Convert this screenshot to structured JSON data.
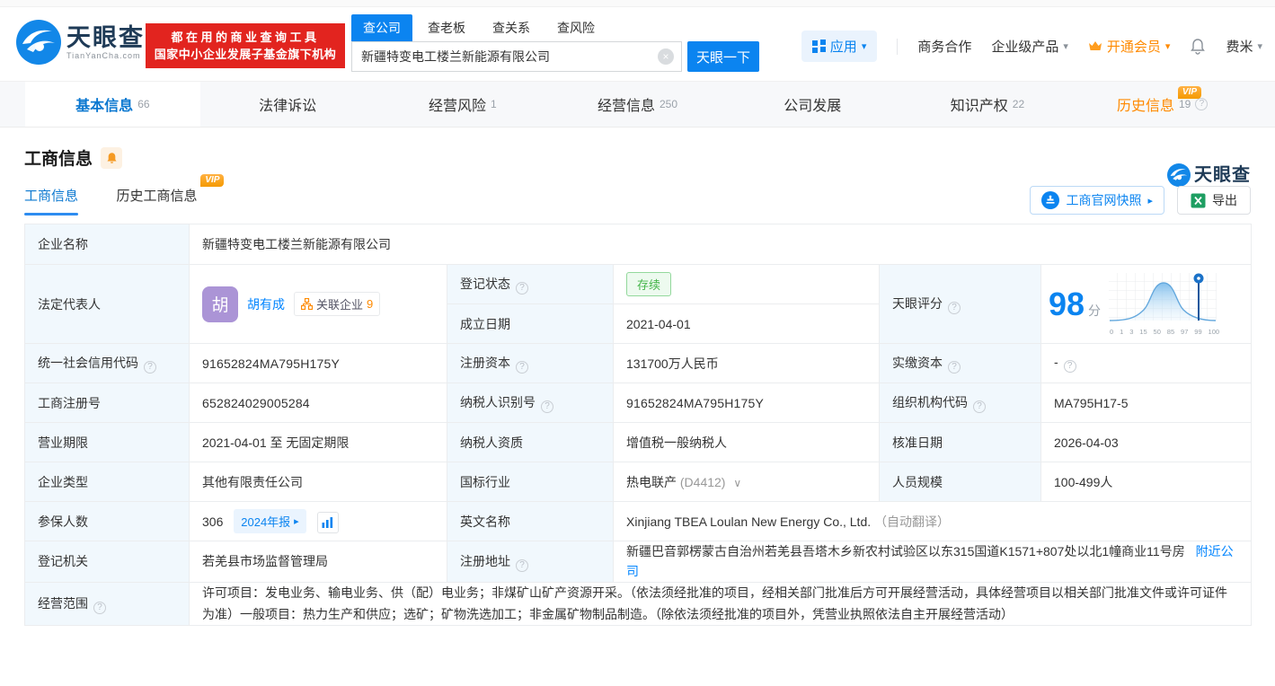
{
  "icons": {
    "caret_down": "▾",
    "play_arrow": "▸",
    "close": "×",
    "help": "?",
    "chevron_down": "∨"
  },
  "badges": {
    "vip": "VIP"
  },
  "colors": {
    "primary_blue": "#0b84f0",
    "link_blue": "#0084ff",
    "brand_red": "#e2241f",
    "vip_orange": "#ff8a00",
    "status_green": "#44b549",
    "label_cell_bg": "#f1f8fd"
  },
  "header": {
    "logo": {
      "brand": "天眼查",
      "domain": "TianYanCha.com"
    },
    "slogan_line1": "都在用的商业查询工具",
    "slogan_line2": "国家中小企业发展子基金旗下机构",
    "search": {
      "tabs": [
        {
          "label": "查公司"
        },
        {
          "label": "查老板"
        },
        {
          "label": "查关系"
        },
        {
          "label": "查风险"
        }
      ],
      "input_value": "新疆特变电工楼兰新能源有限公司",
      "button": "天眼一下"
    },
    "nav": {
      "apps": "应用",
      "cooperation": "商务合作",
      "enterprise": "企业级产品",
      "vip": "开通会员",
      "user": "费米"
    }
  },
  "nav_tabs": [
    {
      "label": "基本信息",
      "count": "66"
    },
    {
      "label": "法律诉讼",
      "count": ""
    },
    {
      "label": "经营风险",
      "count": "1"
    },
    {
      "label": "经营信息",
      "count": "250"
    },
    {
      "label": "公司发展",
      "count": ""
    },
    {
      "label": "知识产权",
      "count": "22"
    },
    {
      "label": "历史信息",
      "count": "19"
    }
  ],
  "section": {
    "title": "工商信息",
    "watermark_brand": "天眼查",
    "subtabs": [
      {
        "label": "工商信息"
      },
      {
        "label": "历史工商信息"
      }
    ],
    "snapshot_button": "工商官网快照",
    "export_button": "导出"
  },
  "table": {
    "company_name": {
      "label": "企业名称",
      "value": "新疆特变电工楼兰新能源有限公司"
    },
    "legal_rep": {
      "label": "法定代表人",
      "avatar": "胡",
      "name": "胡有成",
      "related_label": "关联企业",
      "related_count": "9"
    },
    "reg_status": {
      "label": "登记状态",
      "value": "存续"
    },
    "establish_date": {
      "label": "成立日期",
      "value": "2021-04-01"
    },
    "score": {
      "label": "天眼评分",
      "value": "98",
      "unit": "分",
      "ticks": [
        "0",
        "1",
        "3",
        "15",
        "50",
        "85",
        "97",
        "99",
        "100"
      ]
    },
    "credit_code": {
      "label": "统一社会信用代码",
      "value": "91652824MA795H175Y"
    },
    "reg_capital": {
      "label": "注册资本",
      "value": "131700万人民币"
    },
    "paid_capital": {
      "label": "实缴资本",
      "value": "-"
    },
    "reg_number": {
      "label": "工商注册号",
      "value": "652824029005284"
    },
    "taxpayer_id": {
      "label": "纳税人识别号",
      "value": "91652824MA795H175Y"
    },
    "org_code": {
      "label": "组织机构代码",
      "value": "MA795H17-5"
    },
    "business_term": {
      "label": "营业期限",
      "value": "2021-04-01 至 无固定期限"
    },
    "taxpayer_quality": {
      "label": "纳税人资质",
      "value": "增值税一般纳税人"
    },
    "approval_date": {
      "label": "核准日期",
      "value": "2026-04-03"
    },
    "company_type": {
      "label": "企业类型",
      "value": "其他有限责任公司"
    },
    "industry": {
      "label": "国标行业",
      "value": "热电联产",
      "code": "(D4412)"
    },
    "staff_size": {
      "label": "人员规模",
      "value": "100-499人"
    },
    "insured": {
      "label": "参保人数",
      "value": "306",
      "report_badge": "2024年报"
    },
    "english_name": {
      "label": "英文名称",
      "value": "Xinjiang TBEA Loulan New Energy Co., Ltd.",
      "note": "（自动翻译）"
    },
    "reg_authority": {
      "label": "登记机关",
      "value": "若羌县市场监督管理局"
    },
    "address": {
      "label": "注册地址",
      "value": "新疆巴音郭楞蒙古自治州若羌县吾塔木乡新农村试验区以东315国道K1571+807处以北1幢商业11号房",
      "nearby_link": "附近公司"
    },
    "business_scope": {
      "label": "经营范围",
      "value": "许可项目：发电业务、输电业务、供（配）电业务；非煤矿山矿产资源开采。（依法须经批准的项目，经相关部门批准后方可开展经营活动，具体经营项目以相关部门批准文件或许可证件为准）一般项目：热力生产和供应；选矿；矿物洗选加工；非金属矿物制品制造。（除依法须经批准的项目外，凭营业执照依法自主开展经营活动）"
    }
  }
}
